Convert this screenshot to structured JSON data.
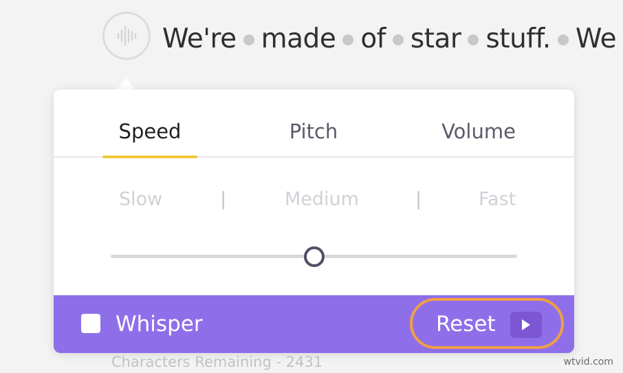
{
  "sentence": {
    "words": [
      "We're",
      "made",
      "of",
      "star",
      "stuff.",
      "We"
    ]
  },
  "voice_button": {
    "icon": "waveform-icon"
  },
  "tabs": [
    {
      "label": "Speed",
      "active": true
    },
    {
      "label": "Pitch",
      "active": false
    },
    {
      "label": "Volume",
      "active": false
    }
  ],
  "speed_scale": {
    "slow": "Slow",
    "separator": "|",
    "medium": "Medium",
    "fast": "Fast",
    "value": 0.5
  },
  "footer": {
    "whisper_label": "Whisper",
    "whisper_checked": false,
    "reset_label": "Reset",
    "play_icon": "play-icon"
  },
  "characters_remaining": "Characters Remaining - 2431",
  "watermark": "wtvid.com",
  "colors": {
    "accent_purple": "#8f6fe9",
    "tab_underline": "#f0c93a",
    "reset_highlight": "#f0a044"
  }
}
